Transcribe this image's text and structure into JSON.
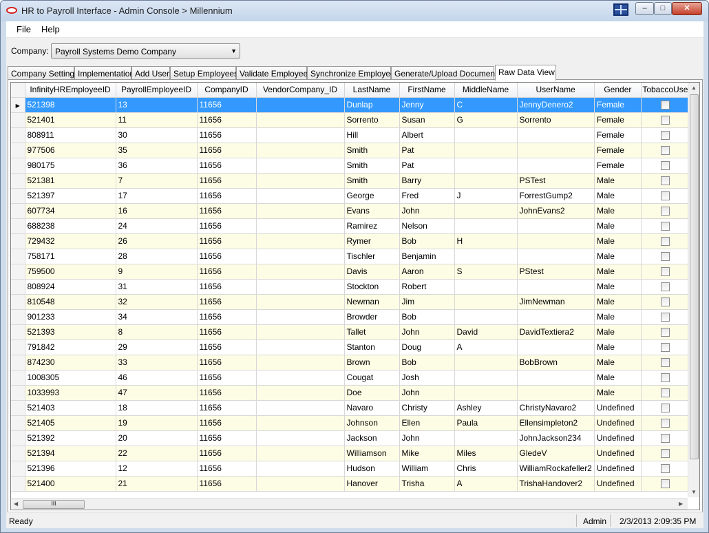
{
  "window": {
    "title": "HR to Payroll Interface - Admin Console > Millennium",
    "minimize": "–",
    "maximize": "□",
    "close": "✕"
  },
  "menu": {
    "file": "File",
    "help": "Help"
  },
  "company": {
    "label": "Company:",
    "selected": "Payroll Systems Demo Company"
  },
  "tabs": [
    "Company Settings",
    "Implementation",
    "Add User",
    "Setup Employees",
    "Validate Employees",
    "Synchronize Employees",
    "Generate/Upload Documents",
    "Raw Data View"
  ],
  "active_tab": "Raw Data View",
  "grid": {
    "columns": [
      "InfinityHREmployeeID",
      "PayrollEmployeeID",
      "CompanyID",
      "VendorCompany_ID",
      "LastName",
      "FirstName",
      "MiddleName",
      "UserName",
      "Gender",
      "TobaccoUse"
    ],
    "rows": [
      [
        "521398",
        "13",
        "11656",
        "",
        "Dunlap",
        "Jenny",
        "C",
        "JennyDenero2",
        "Female"
      ],
      [
        "521401",
        "11",
        "11656",
        "",
        "Sorrento",
        "Susan",
        "G",
        "Sorrento",
        "Female"
      ],
      [
        "808911",
        "30",
        "11656",
        "",
        "Hill",
        "Albert",
        "",
        "",
        "Female"
      ],
      [
        "977506",
        "35",
        "11656",
        "",
        "Smith",
        "Pat",
        "",
        "",
        "Female"
      ],
      [
        "980175",
        "36",
        "11656",
        "",
        "Smith",
        "Pat",
        "",
        "",
        "Female"
      ],
      [
        "521381",
        "7",
        "11656",
        "",
        "Smith",
        "Barry",
        "",
        "PSTest",
        "Male"
      ],
      [
        "521397",
        "17",
        "11656",
        "",
        "George",
        "Fred",
        "J",
        "ForrestGump2",
        "Male"
      ],
      [
        "607734",
        "16",
        "11656",
        "",
        "Evans",
        "John",
        "",
        "JohnEvans2",
        "Male"
      ],
      [
        "688238",
        "24",
        "11656",
        "",
        "Ramirez",
        "Nelson",
        "",
        "",
        "Male"
      ],
      [
        "729432",
        "26",
        "11656",
        "",
        "Rymer",
        "Bob",
        "H",
        "",
        "Male"
      ],
      [
        "758171",
        "28",
        "11656",
        "",
        "Tischler",
        "Benjamin",
        "",
        "",
        "Male"
      ],
      [
        "759500",
        "9",
        "11656",
        "",
        "Davis",
        "Aaron",
        "S",
        "PStest",
        "Male"
      ],
      [
        "808924",
        "31",
        "11656",
        "",
        "Stockton",
        "Robert",
        "",
        "",
        "Male"
      ],
      [
        "810548",
        "32",
        "11656",
        "",
        "Newman",
        "Jim",
        "",
        "JimNewman",
        "Male"
      ],
      [
        "901233",
        "34",
        "11656",
        "",
        "Browder",
        "Bob",
        "",
        "",
        "Male"
      ],
      [
        "521393",
        "8",
        "11656",
        "",
        "Tallet",
        "John",
        "David",
        "DavidTextiera2",
        "Male"
      ],
      [
        "791842",
        "29",
        "11656",
        "",
        "Stanton",
        "Doug",
        "A",
        "",
        "Male"
      ],
      [
        "874230",
        "33",
        "11656",
        "",
        "Brown",
        "Bob",
        "",
        "BobBrown",
        "Male"
      ],
      [
        "1008305",
        "46",
        "11656",
        "",
        "Cougat",
        "Josh",
        "",
        "",
        "Male"
      ],
      [
        "1033993",
        "47",
        "11656",
        "",
        "Doe",
        "John",
        "",
        "",
        "Male"
      ],
      [
        "521403",
        "18",
        "11656",
        "",
        "Navaro",
        "Christy",
        "Ashley",
        "ChristyNavaro2",
        "Undefined"
      ],
      [
        "521405",
        "19",
        "11656",
        "",
        "Johnson",
        "Ellen",
        "Paula",
        "Ellensimpleton2",
        "Undefined"
      ],
      [
        "521392",
        "20",
        "11656",
        "",
        "Jackson",
        "John",
        "",
        "JohnJackson234",
        "Undefined"
      ],
      [
        "521394",
        "22",
        "11656",
        "",
        "Williamson",
        "Mike",
        "Miles",
        "GledeV",
        "Undefined"
      ],
      [
        "521396",
        "12",
        "11656",
        "",
        "Hudson",
        "William",
        "Chris",
        "WilliamRockafeller2",
        "Undefined"
      ],
      [
        "521400",
        "21",
        "11656",
        "",
        "Hanover",
        "Trisha",
        "A",
        "TrishaHandover2",
        "Undefined"
      ]
    ],
    "selected_row": 0
  },
  "status": {
    "text": "Ready",
    "user": "Admin",
    "datetime": "2/3/2013 2:09:35 PM"
  },
  "colors": {
    "selection": "#3399ff",
    "alt_row": "#fdfde5",
    "titlebar": "#c4d5ea"
  },
  "icons": {
    "app": "app-logo-icon",
    "monitor": "monitor-icon"
  }
}
